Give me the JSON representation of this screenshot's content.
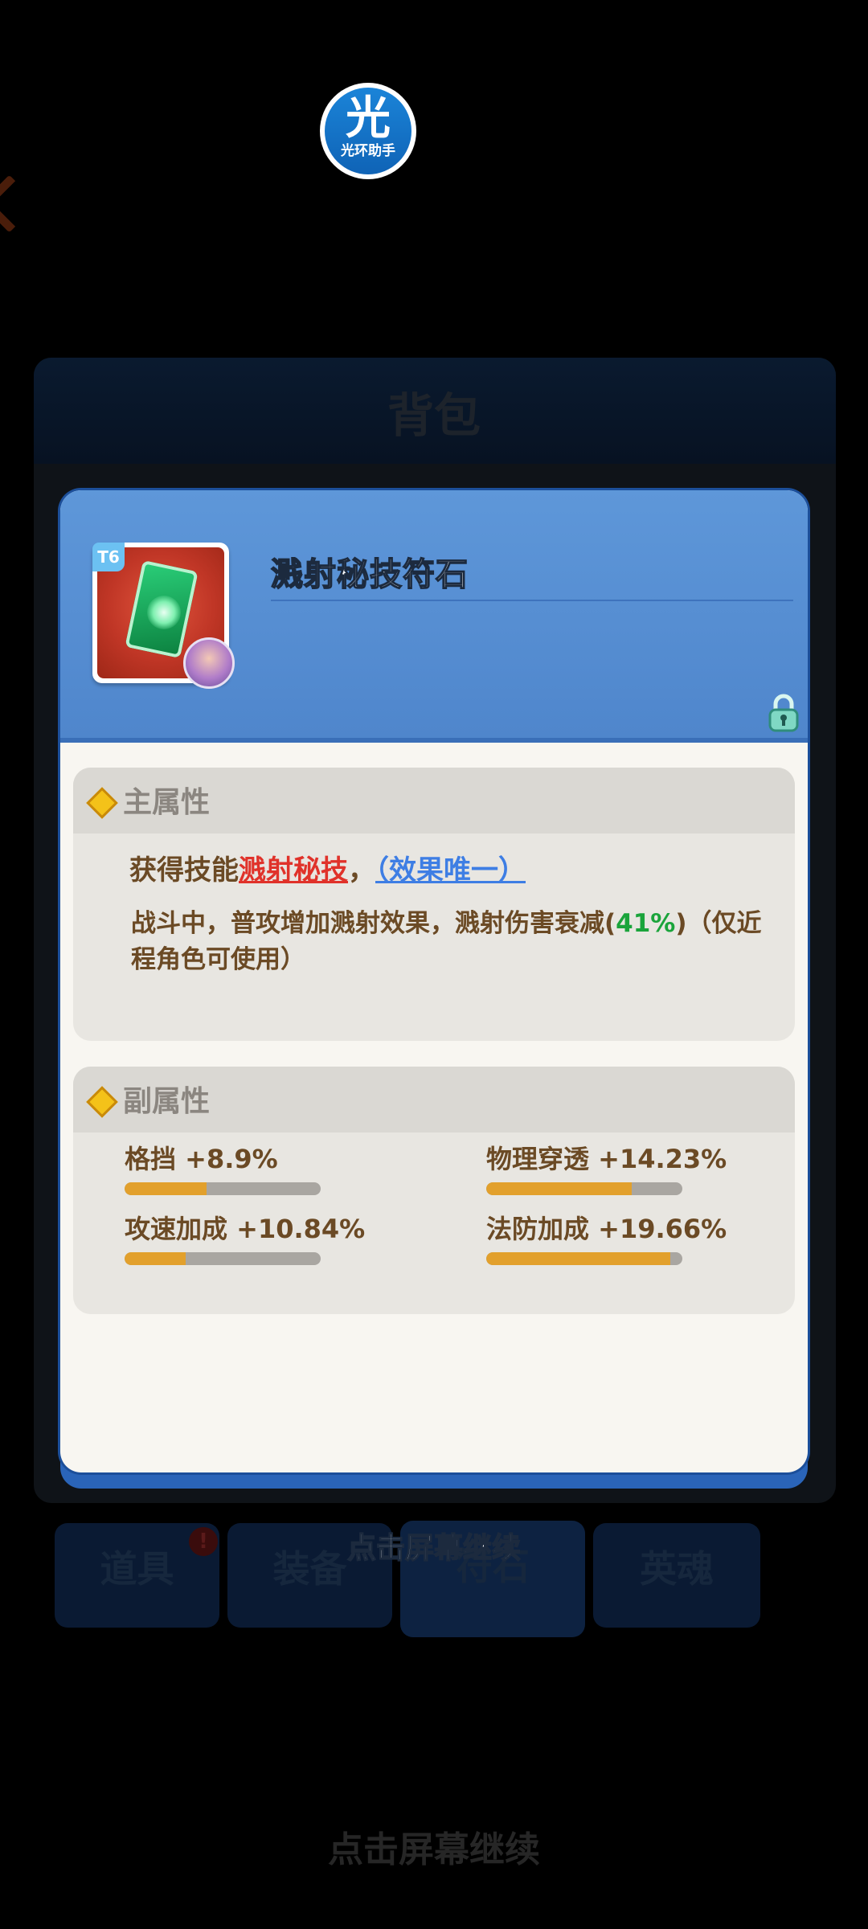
{
  "assistant_badge": {
    "big": "光",
    "small": "光环助手"
  },
  "background": {
    "title": "背包",
    "tabs": [
      "道具",
      "装备",
      "符石",
      "英魂"
    ],
    "alert": "!",
    "continue_text": "点击屏幕继续"
  },
  "item": {
    "tier": "T6",
    "name": "溅射秘技符石"
  },
  "main_attr": {
    "title": "主属性",
    "prefix": "获得技能",
    "skill": "溅射秘技",
    "comma": "，",
    "unique": "（效果唯一）",
    "desc_before": "战斗中，普攻增加溅射效果，溅射伤害衰减(",
    "desc_value": "41%",
    "desc_after": ")（仅近程角色可使用）"
  },
  "sub_attr": {
    "title": "副属性",
    "stats": [
      {
        "label": "格挡 +8.9%",
        "fill": 0.42
      },
      {
        "label": "物理穿透 +14.23%",
        "fill": 0.74
      },
      {
        "label": "攻速加成 +10.84%",
        "fill": 0.31
      },
      {
        "label": "法防加成 +19.66%",
        "fill": 0.94
      }
    ]
  },
  "continue_text": "点击屏幕继续",
  "colors": {
    "header_blue": "#5e97d9",
    "skill_red": "#e0322a",
    "skill_blue": "#3e7ee4",
    "value_green": "#1aa43b",
    "bar_fill": "#e2a02c"
  }
}
